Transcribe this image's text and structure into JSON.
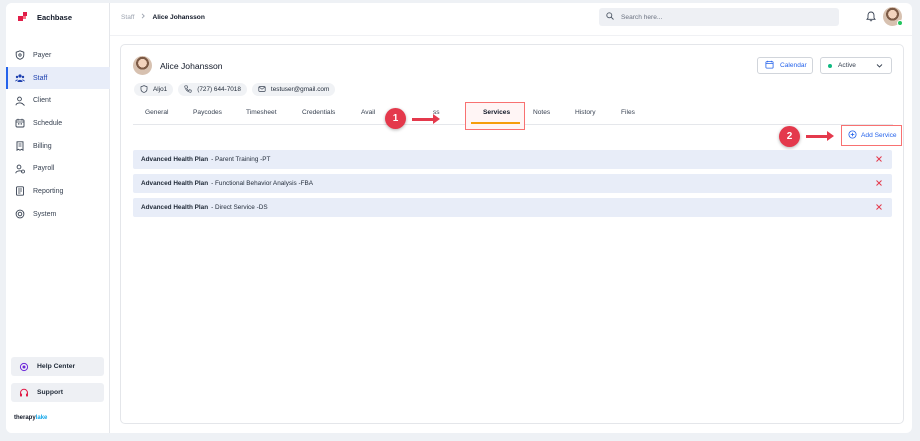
{
  "app": {
    "name": "Eachbase",
    "footer_brand_a": "therapy",
    "footer_brand_b": "lake"
  },
  "sidebar": {
    "items": [
      {
        "label": "Payer",
        "icon": "shield-icon",
        "active": false
      },
      {
        "label": "Staff",
        "icon": "users-icon",
        "active": true
      },
      {
        "label": "Client",
        "icon": "client-icon",
        "active": false
      },
      {
        "label": "Schedule",
        "icon": "calendar-icon",
        "active": false
      },
      {
        "label": "Billing",
        "icon": "billing-icon",
        "active": false
      },
      {
        "label": "Payroll",
        "icon": "payroll-icon",
        "active": false
      },
      {
        "label": "Reporting",
        "icon": "report-icon",
        "active": false
      },
      {
        "label": "System",
        "icon": "system-icon",
        "active": false
      }
    ],
    "help_label": "Help Center",
    "support_label": "Support"
  },
  "header": {
    "breadcrumb_parent": "Staff",
    "breadcrumb_current": "Alice Johansson",
    "search_placeholder": "Search here..."
  },
  "profile": {
    "name": "Alice Johansson",
    "id": "Aljo1",
    "phone": "(727) 644-7018",
    "email": "testuser@gmail.com",
    "calendar_label": "Calendar",
    "status": "Active"
  },
  "tabs": [
    {
      "label": "General"
    },
    {
      "label": "Paycodes"
    },
    {
      "label": "Timesheet"
    },
    {
      "label": "Credentials"
    },
    {
      "label": "Avail"
    },
    {
      "label": "ss"
    },
    {
      "label": "Services",
      "active": true
    },
    {
      "label": "Notes"
    },
    {
      "label": "History"
    },
    {
      "label": "Files"
    }
  ],
  "steps": {
    "one": "1",
    "two": "2"
  },
  "add_service_label": "Add Service",
  "services": [
    {
      "plan": "Advanced Health Plan",
      "desc": "- Parent Training -PT"
    },
    {
      "plan": "Advanced Health Plan",
      "desc": "- Functional Behavior Analysis -FBA"
    },
    {
      "plan": "Advanced Health Plan",
      "desc": "- Direct Service -DS"
    }
  ],
  "colors": {
    "accent": "#2563eb",
    "callout": "#e4394c",
    "active_tab_underline": "#f59e0b",
    "status": "#10b981"
  }
}
